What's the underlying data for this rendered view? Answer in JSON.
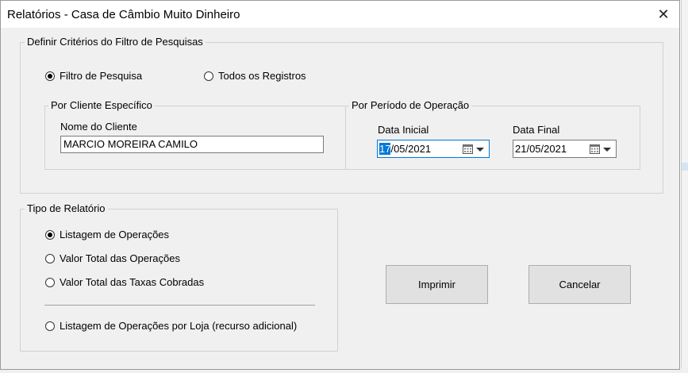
{
  "window": {
    "title": "Relatórios - Casa de Câmbio Muito Dinheiro",
    "close_glyph": "✕"
  },
  "criteria": {
    "legend": "Definir Critérios do Filtro de Pesquisas",
    "filter_option": {
      "label": "Filtro de Pesquisa",
      "selected": true
    },
    "all_option": {
      "label": "Todos os Registros",
      "selected": false
    },
    "client_group": {
      "legend": "Por Cliente Específico",
      "name_label": "Nome do Cliente",
      "name_value": "MARCIO MOREIRA CAMILO"
    },
    "period_group": {
      "legend": "Por Período de Operação",
      "start_label": "Data Inicial",
      "start_day": "17",
      "start_rest": "/05/2021",
      "end_label": "Data Final",
      "end_value": "21/05/2021"
    }
  },
  "report_type": {
    "legend": "Tipo de Relatório",
    "options": [
      {
        "label": "Listagem de Operações",
        "selected": true
      },
      {
        "label": "Valor Total das Operações",
        "selected": false
      },
      {
        "label": "Valor Total das Taxas Cobradas",
        "selected": false
      },
      {
        "label": "Listagem de Operações por Loja (recurso adicional)",
        "selected": false
      }
    ]
  },
  "actions": {
    "print_label": "Imprimir",
    "cancel_label": "Cancelar"
  },
  "colors": {
    "accent": "#0078d7",
    "dialog_bg": "#f0f0f0",
    "button_bg": "#e1e1e1"
  }
}
